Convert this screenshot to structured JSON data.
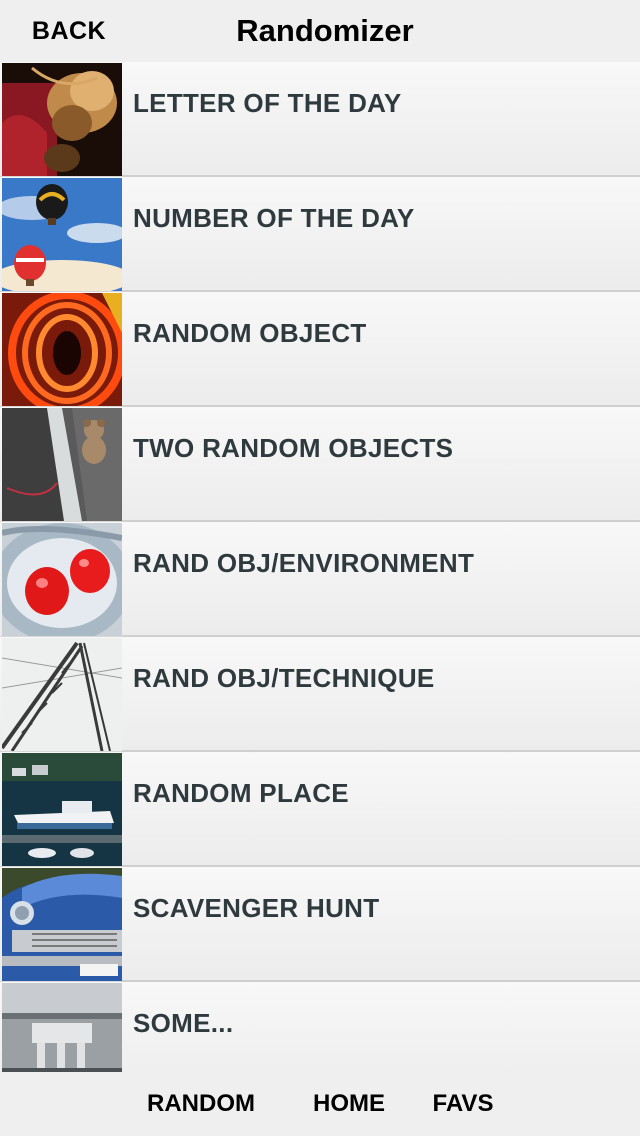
{
  "navbar": {
    "back_label": "BACK",
    "title": "Randomizer"
  },
  "list": {
    "items": [
      {
        "label": "LETTER OF THE DAY",
        "image": "woman-with-curls-thumbnail"
      },
      {
        "label": "NUMBER OF THE DAY",
        "image": "hot-air-balloons-thumbnail"
      },
      {
        "label": "RANDOM OBJECT",
        "image": "orange-light-coils-thumbnail"
      },
      {
        "label": "TWO RANDOM OBJECTS",
        "image": "teddy-bear-in-tent-thumbnail"
      },
      {
        "label": "RAND OBJ/ENVIRONMENT",
        "image": "red-candies-in-ice-thumbnail"
      },
      {
        "label": "RAND OBJ/TECHNIQUE",
        "image": "power-pylon-thumbnail"
      },
      {
        "label": "RANDOM PLACE",
        "image": "harbor-boats-thumbnail"
      },
      {
        "label": "SCAVENGER HUNT",
        "image": "vintage-blue-car-thumbnail"
      },
      {
        "label": "SOME...",
        "image": "gray-building-thumbnail"
      }
    ]
  },
  "tabbar": {
    "random_label": "RANDOM",
    "home_label": "HOME",
    "favs_label": "FAVS"
  }
}
